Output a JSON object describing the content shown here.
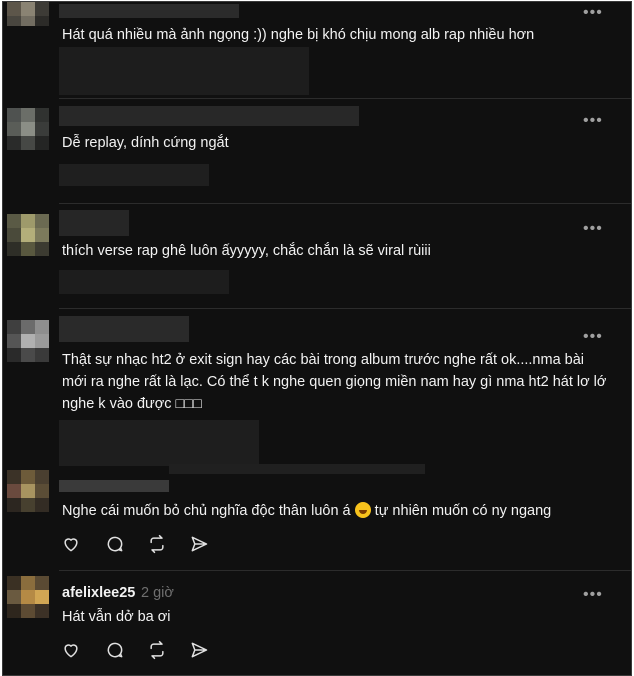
{
  "comments": [
    {
      "text": "Hát quá nhiều mà ảnh ngọng :)) nghe bị khó chịu mong alb rap nhiều hơn"
    },
    {
      "text": "Dễ replay, dính cứng ngắt"
    },
    {
      "text": "thích verse rap ghê luôn ấyyyyy, chắc chắn là sẽ viral rùiii"
    },
    {
      "text": "Thật sự nhạc ht2 ở exit sign hay các bài trong album trước nghe rất ok....nma bài mới ra nghe rất là lạc. Có thể t k nghe quen giọng miền nam hay gì nma ht2 hát lơ lớ nghe k vào được",
      "emoji_placeholders": "□□□"
    },
    {
      "text_before": "Nghe cái muốn bỏ chủ nghĩa độc thân luôn á",
      "emoji": "rolling-laughing-emoji",
      "text_after": "tự nhiên muốn có ny ngang"
    },
    {
      "username": "afelixlee25",
      "time": "2 giờ",
      "text": "Hát vẫn dở ba ơi"
    }
  ],
  "more_label": "•••",
  "actions": [
    "heart-icon",
    "comment-icon",
    "repost-icon",
    "share-icon"
  ],
  "colors": {
    "background": "#101010",
    "text": "#f3f3f3",
    "muted": "#6f6f6f"
  }
}
